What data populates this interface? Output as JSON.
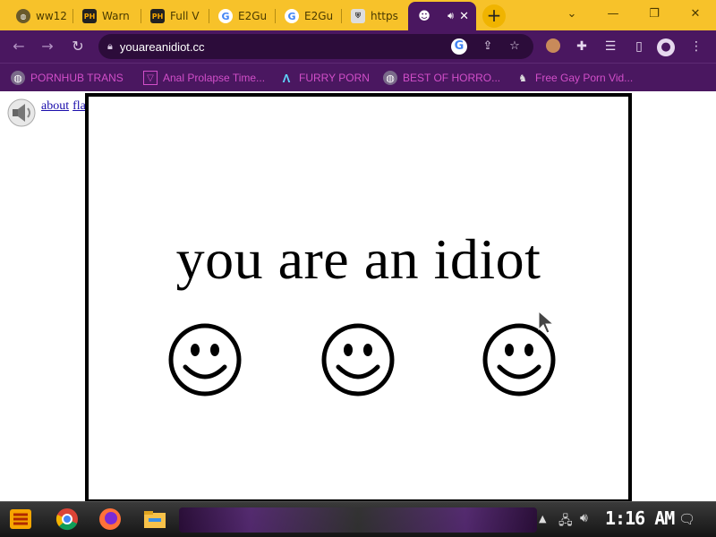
{
  "tabs": [
    {
      "icon": "globe-icon",
      "label": "ww12"
    },
    {
      "icon": "ph-icon",
      "label": "Warn"
    },
    {
      "icon": "ph-icon",
      "label": "Full V"
    },
    {
      "icon": "google-icon",
      "label": "E2Gu"
    },
    {
      "icon": "google-icon",
      "label": "E2Gu"
    },
    {
      "icon": "shield-icon",
      "label": "https"
    },
    {
      "icon": "smiley-icon",
      "label": ""
    }
  ],
  "tab_icon_text": {
    "ph": "PH",
    "google": "G"
  },
  "new_tab_label": "+",
  "toolbar": {
    "url": "youareanidiot.cc"
  },
  "bookmarks": [
    {
      "icon": "globe-icon",
      "label": "PORNHUB TRANS"
    },
    {
      "icon": "v-icon",
      "label": "Anal Prolapse Time..."
    },
    {
      "icon": "a-icon",
      "label": "FURRY PORN"
    },
    {
      "icon": "globe-icon",
      "label": "BEST OF HORRO..."
    },
    {
      "icon": "fox-icon",
      "label": "Free Gay Porn Vid..."
    }
  ],
  "page": {
    "links": {
      "about": "about",
      "flash": "flash"
    },
    "headline": "you are an idiot"
  },
  "taskbar": {
    "clock": "1:16 AM"
  },
  "colors": {
    "tab_strip": "#f7c22a",
    "toolbar": "#4a1760",
    "bookmark_text": "#d14ec9"
  }
}
